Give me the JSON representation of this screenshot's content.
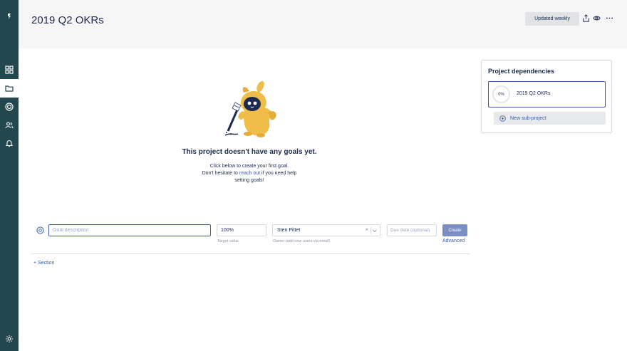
{
  "header": {
    "title": "2019 Q2 OKRs",
    "update_button": "Updated weekly",
    "icons": [
      "share-icon",
      "eye-icon",
      "more-icon"
    ]
  },
  "sidebar": {
    "icons": [
      "logo-icon",
      "grid-icon",
      "folder-icon",
      "target-icon",
      "users-icon",
      "bell-icon",
      "gear-icon"
    ],
    "active": "folder-icon"
  },
  "empty_state": {
    "title": "This project doesn't have any goals yet.",
    "line1": "Click below to create your first goal.",
    "line2_prefix": "Don't hesitate to ",
    "line2_link": "reach out",
    "line2_suffix": " if you need help",
    "line3": "setting goals!"
  },
  "goal_form": {
    "description_placeholder": "Goal description",
    "target_value": "100%",
    "target_hint": "Target value",
    "owner_value": "Sten Pittet",
    "owner_hint": "Owner (add new users via email)",
    "due_placeholder": "Due date (optional)",
    "create_label": "Create",
    "advanced_label": "Advanced"
  },
  "section_link": "+ Section",
  "dependencies": {
    "title": "Project dependencies",
    "project": {
      "progress": "0%",
      "name": "2019 Q2 OKRs"
    },
    "new_subproject": "New sub-project"
  },
  "colors": {
    "sidebar": "#23474f",
    "accent": "#3b5da0",
    "mascot": "#efbd48",
    "create_button": "#7a8fc4"
  }
}
